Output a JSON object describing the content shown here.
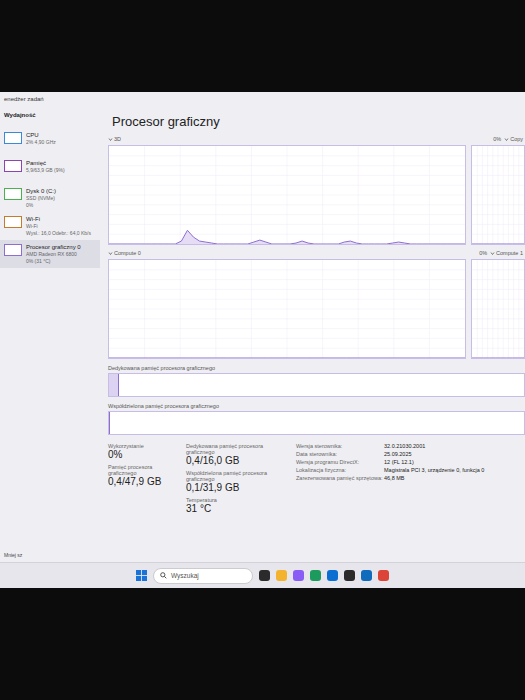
{
  "window": {
    "title": "enedżer zadań"
  },
  "section": "Wydajność",
  "sidebar": {
    "items": [
      {
        "name": "CPU",
        "details": [
          "2% 4,90 GHz"
        ],
        "selected": false,
        "color": "#3b8ad9"
      },
      {
        "name": "Pamięć",
        "details": [
          "5,9/63,9 GB (9%)"
        ],
        "selected": false,
        "color": "#8e44ad"
      },
      {
        "name": "Dysk 0 (C:)",
        "details": [
          "SSD (NVMe)",
          "0%"
        ],
        "selected": false,
        "color": "#4caf50"
      },
      {
        "name": "Wi-Fi",
        "details": [
          "Wi-Fi",
          "Wysł.: 16,0 Odebr.: 64,0 Kb/s"
        ],
        "selected": false,
        "color": "#c27c2c"
      },
      {
        "name": "Procesor graficzny 0",
        "details": [
          "AMD Radeon RX 6800",
          "0% (31 °C)"
        ],
        "selected": true,
        "color": "#8e6fd0"
      }
    ],
    "footer": "Mniej sz"
  },
  "page": {
    "title": "Procesor graficzny"
  },
  "charts": [
    {
      "name": "3D",
      "reading": "",
      "values": [
        0,
        0,
        0,
        0,
        0,
        0,
        0,
        0,
        0,
        0,
        0,
        0,
        3,
        14,
        7,
        3,
        2,
        1,
        0,
        0,
        0,
        0,
        0,
        0,
        2,
        4,
        2,
        0,
        0,
        0,
        0,
        1,
        3,
        1,
        0,
        0,
        0,
        0,
        0,
        2,
        3,
        1,
        0,
        0,
        0,
        0,
        0,
        1,
        2,
        1,
        0,
        0,
        0,
        0,
        0,
        0,
        0,
        0,
        0,
        0
      ]
    },
    {
      "name": "Copy",
      "reading": "0%",
      "values": [
        0,
        0,
        0,
        0,
        0,
        0,
        0,
        0,
        0,
        0
      ]
    },
    {
      "name": "Compute 0",
      "reading": "",
      "values": [
        0,
        0,
        0,
        0,
        0,
        0,
        0,
        0,
        0,
        0
      ]
    },
    {
      "name": "Compute 1",
      "reading": "0%",
      "values": [
        0,
        0,
        0,
        0,
        0,
        0,
        0,
        0,
        0,
        0
      ]
    }
  ],
  "memory_bars": [
    {
      "label": "Dedykowana pamięć procesora graficznego",
      "level": 0.025
    },
    {
      "label": "Współdzielona pamięć procesora graficznego",
      "level": 0.003
    }
  ],
  "stats": [
    [
      {
        "label": "Wykorzystanie",
        "value": "0%"
      },
      {
        "label": "Pamięć procesora graficznego",
        "value": "0,4/47,9 GB"
      }
    ],
    [
      {
        "label": "Dedykowana pamięć procesora graficznego",
        "value": "0,4/16,0 GB"
      },
      {
        "label": "Współdzielona pamięć procesora graficznego",
        "value": "0,1/31,9 GB"
      },
      {
        "label": "Temperatura",
        "value": "31 °C"
      }
    ]
  ],
  "details": [
    {
      "label": "Wersja sterownika:",
      "value": "32.0.21030.2001"
    },
    {
      "label": "Data sterownika:",
      "value": "25.09.2025"
    },
    {
      "label": "Wersja programu DirectX:",
      "value": "12 (FL 12.1)"
    },
    {
      "label": "Lokalizacja fizyczna:",
      "value": "Magistrala PCI 3, urządzenie 0, funkcja 0"
    },
    {
      "label": "Zarezerwowana pamięć sprzętowa:",
      "value": "46,8 MB"
    }
  ],
  "taskbar": {
    "search_placeholder": "Wyszukaj",
    "apps": [
      {
        "color": "#2b2b2b"
      },
      {
        "color": "#f3b32f"
      },
      {
        "color": "#8a5cf6"
      },
      {
        "color": "#1d9b5f"
      },
      {
        "color": "#0b6fd1"
      },
      {
        "color": "#2b2b2b"
      },
      {
        "color": "#0f6cbd"
      },
      {
        "color": "#db4437"
      }
    ]
  }
}
